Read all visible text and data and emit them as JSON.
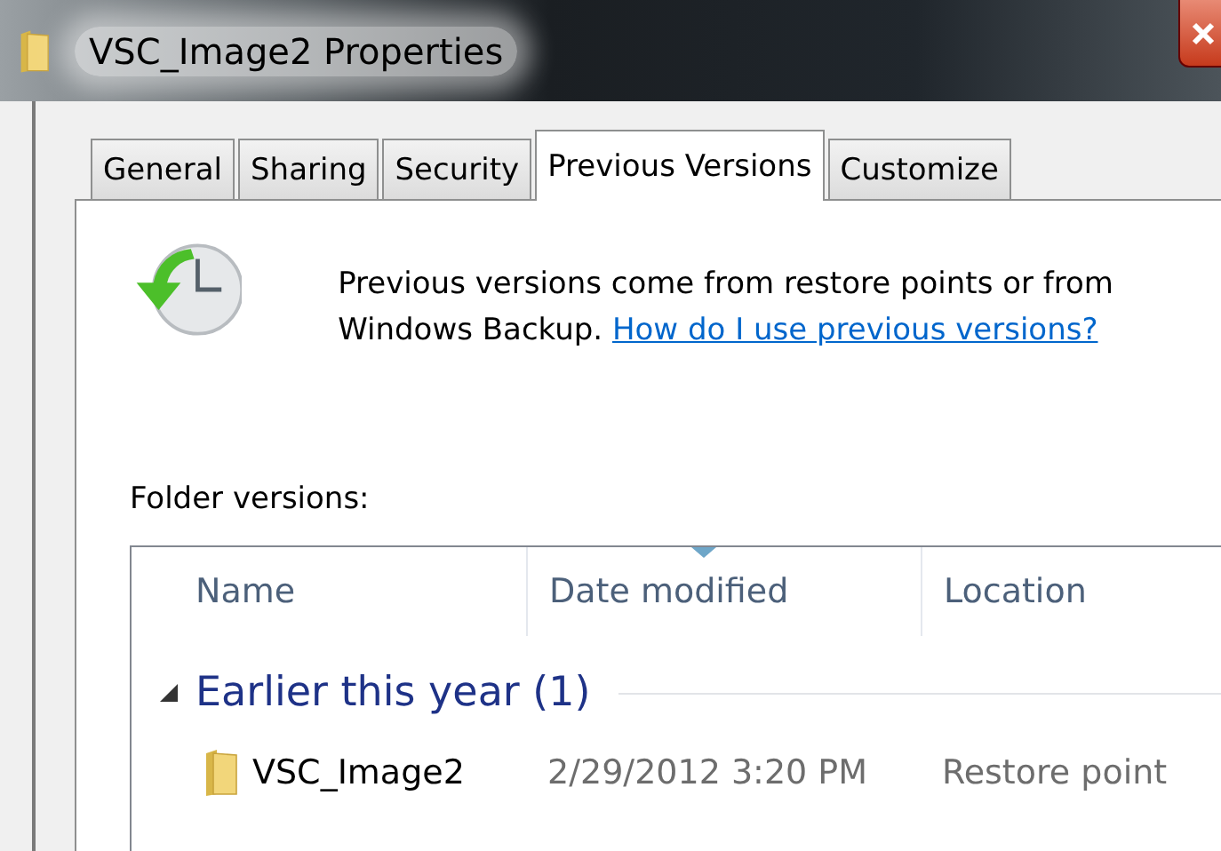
{
  "window": {
    "title": "VSC_Image2 Properties"
  },
  "tabs": [
    {
      "label": "General",
      "selected": false
    },
    {
      "label": "Sharing",
      "selected": false
    },
    {
      "label": "Security",
      "selected": false
    },
    {
      "label": "Previous Versions",
      "selected": true
    },
    {
      "label": "Customize",
      "selected": false
    }
  ],
  "info": {
    "text": "Previous versions come from restore points or from Windows Backup.",
    "link": "How do I use previous versions?"
  },
  "list_label": "Folder versions:",
  "columns": [
    {
      "label": "Name",
      "sorted": false
    },
    {
      "label": "Date modified",
      "sorted": true
    },
    {
      "label": "Location",
      "sorted": false
    }
  ],
  "groups": [
    {
      "label": "Earlier this year (1)",
      "expanded": true,
      "rows": [
        {
          "name": "VSC_Image2",
          "date": "2/29/2012 3:20 PM",
          "location": "Restore point"
        }
      ]
    }
  ]
}
